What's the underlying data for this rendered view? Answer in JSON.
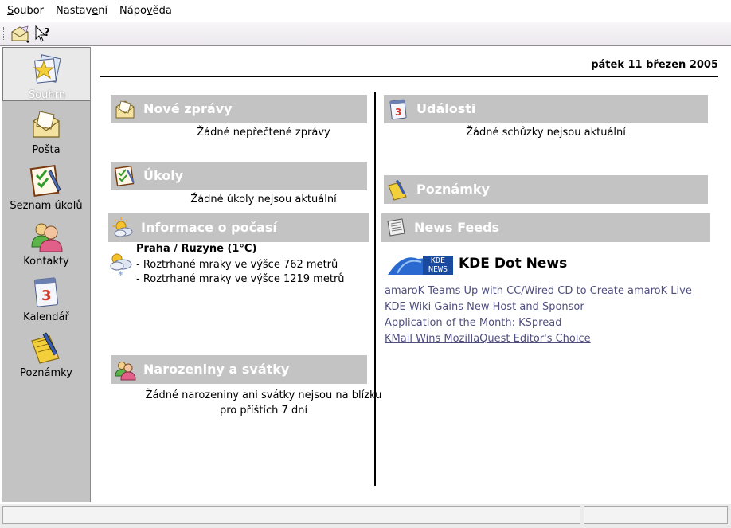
{
  "menu": {
    "file": {
      "pre": "",
      "u": "S",
      "post": "oubor"
    },
    "settings": {
      "pre": "Nastav",
      "u": "e",
      "post": "ní"
    },
    "help": {
      "pre": "Nápo",
      "u": "v",
      "post": "ěda"
    }
  },
  "toolbar": {
    "buttons": [
      {
        "icon": "new-message-icon"
      },
      {
        "icon": "whats-this-icon"
      }
    ]
  },
  "sidebar": {
    "items": [
      {
        "label": "Souhrn",
        "icon": "summary-icon",
        "active": true
      },
      {
        "label": "Pošta",
        "icon": "mail-icon",
        "active": false
      },
      {
        "label": "Seznam úkolů",
        "icon": "todo-icon",
        "active": false
      },
      {
        "label": "Kontakty",
        "icon": "contacts-icon",
        "active": false
      },
      {
        "label": "Kalendář",
        "icon": "calendar-icon",
        "active": false
      },
      {
        "label": "Poznámky",
        "icon": "notes-icon",
        "active": false
      }
    ]
  },
  "main": {
    "date": "pátek 11 březen 2005",
    "left": {
      "mail": {
        "title": "Nové zprávy",
        "text": "Žádné nepřečtené zprávy"
      },
      "todo": {
        "title": "Úkoly",
        "text": "Žádné úkoly nejsou aktuální"
      },
      "weather": {
        "title": "Informace o počasí",
        "location": "Praha / Ruzyne (1°C)",
        "lines": [
          "- Roztrhané mraky ve výšce 762 metrů",
          "- Roztrhané mraky ve výšce 1219 metrů"
        ]
      },
      "birthdays": {
        "title": "Narozeniny a svátky",
        "text_1": "Žádné narozeniny ani svátky nejsou na blízku",
        "text_2": "pro příštích 7 dní"
      }
    },
    "right": {
      "events": {
        "title": "Události",
        "text": "Žádné schůzky nejsou aktuální",
        "icon_number": "3"
      },
      "notes": {
        "title": "Poznámky"
      },
      "news": {
        "title": "News Feeds",
        "feed_title": "KDE Dot News",
        "logo_text": "KDE NEWS",
        "items": [
          "amaroK Teams Up with CC/Wired CD to Create amaroK Live",
          "KDE Wiki Gains New Host and Sponsor",
          "Application of the Month: KSpread",
          "KMail Wins MozillaQuest Editor's Choice"
        ]
      }
    }
  },
  "colors": {
    "panel_header": "#c3c3c3",
    "sidebar": "#c3c3c3",
    "link": "#4f4f7f"
  }
}
